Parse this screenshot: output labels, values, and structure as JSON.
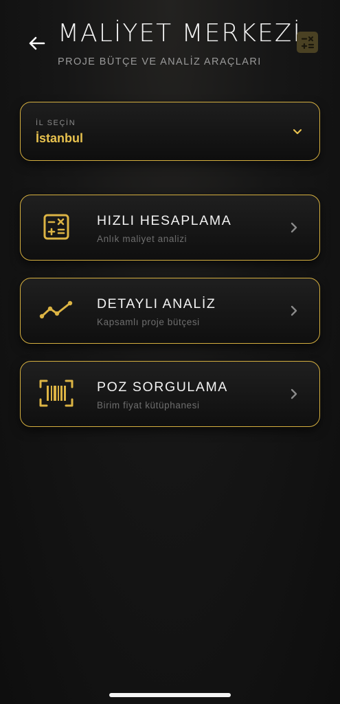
{
  "header": {
    "title": "MALİYET MERKEZİ",
    "subtitle": "PROJE BÜTÇE VE ANALİZ ARAÇLARI",
    "back_icon": "arrow-left-icon",
    "badge_icon": "calculator-icon"
  },
  "city": {
    "label": "İL SEÇİN",
    "value": "İstanbul"
  },
  "cards": [
    {
      "title": "HIZLI HESAPLAMA",
      "subtitle": "Anlık maliyet analizi",
      "icon": "calculator-icon"
    },
    {
      "title": "DETAYLI ANALİZ",
      "subtitle": "Kapsamlı proje bütçesi",
      "icon": "trend-line-icon"
    },
    {
      "title": "POZ SORGULAMA",
      "subtitle": "Birim fiyat kütüphanesi",
      "icon": "barcode-scan-icon"
    }
  ],
  "colors": {
    "accent": "#d6b040",
    "accent_text": "#e7c14e",
    "background": "#141414"
  }
}
